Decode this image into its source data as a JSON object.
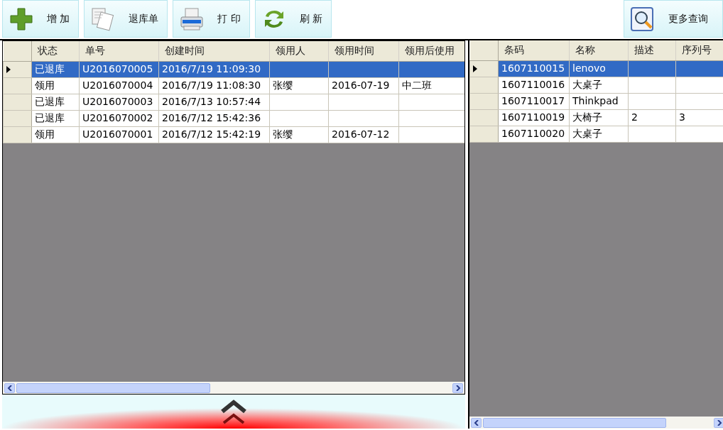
{
  "toolbar": {
    "buttons": [
      {
        "label": "增 加",
        "kind": "add"
      },
      {
        "label": "退库单",
        "kind": "docs"
      },
      {
        "label": "打 印",
        "kind": "print"
      },
      {
        "label": "刷 新",
        "kind": "refresh"
      }
    ],
    "right_buttons": [
      {
        "label": "更多查询",
        "kind": "search"
      }
    ]
  },
  "orders_table": {
    "columns": [
      "状态",
      "单号",
      "创建时间",
      "领用人",
      "领用时间",
      "领用后使用"
    ],
    "rows": [
      {
        "selected": true,
        "cells": [
          "已退库",
          "U2016070005",
          "2016/7/19 11:09:30",
          "",
          "",
          ""
        ]
      },
      {
        "selected": false,
        "cells": [
          "领用",
          "U2016070004",
          "2016/7/19 11:08:30",
          "张缨",
          "2016-07-19",
          "中二班"
        ]
      },
      {
        "selected": false,
        "cells": [
          "已退库",
          "U2016070003",
          "2016/7/13 10:57:44",
          "",
          "",
          ""
        ]
      },
      {
        "selected": false,
        "cells": [
          "已退库",
          "U2016070002",
          "2016/7/12 15:42:36",
          "",
          "",
          ""
        ]
      },
      {
        "selected": false,
        "cells": [
          "领用",
          "U2016070001",
          "2016/7/12 15:42:19",
          "张缨",
          "2016-07-12",
          ""
        ]
      }
    ]
  },
  "items_table": {
    "columns": [
      "条码",
      "名称",
      "描述",
      "序列号"
    ],
    "rows": [
      {
        "selected": true,
        "cells": [
          "1607110015",
          "lenovo",
          "",
          ""
        ]
      },
      {
        "selected": false,
        "cells": [
          "1607110016",
          "大桌子",
          "",
          ""
        ]
      },
      {
        "selected": false,
        "cells": [
          "1607110017",
          "Thinkpad",
          "",
          ""
        ]
      },
      {
        "selected": false,
        "cells": [
          "1607110019",
          "大椅子",
          "2",
          "3"
        ]
      },
      {
        "selected": false,
        "cells": [
          "1607110020",
          "大桌子",
          "",
          ""
        ]
      }
    ]
  }
}
